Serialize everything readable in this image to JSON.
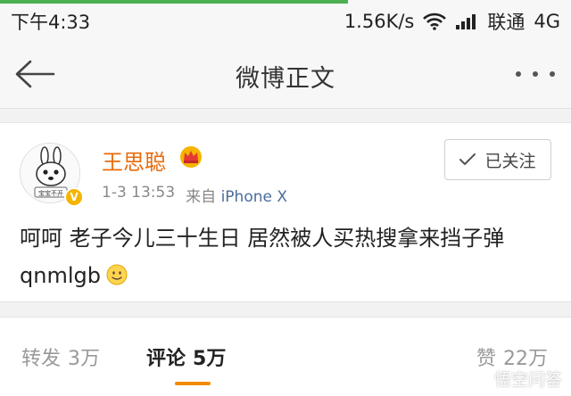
{
  "status_bar": {
    "time": "下午4:33",
    "network_speed": "1.56K/s",
    "carrier": "联通",
    "network_type": "4G",
    "progress_color": "#4caf50"
  },
  "nav": {
    "title": "微博正文",
    "back_icon": "arrow-left-icon",
    "more_icon": "more-dots-icon"
  },
  "post": {
    "username": "王思聪",
    "username_color": "#e86b0c",
    "badge_icon": "crown-icon",
    "avatar_text": "宝宝不开",
    "time": "1-3 13:53",
    "source_prefix": "来自",
    "device": "iPhone X",
    "follow_label": "已关注",
    "text": "呵呵 老子今儿三十生日 居然被人买热搜拿来挡子弹 qnmlgb",
    "emoji_icon": "smiley-emoji-icon"
  },
  "tabs": {
    "repost": {
      "label": "转发",
      "count": "3万"
    },
    "comment": {
      "label": "评论",
      "count": "5万"
    },
    "like": {
      "label": "赞",
      "count": "22万"
    },
    "accent_color": "#f28c00"
  },
  "watermark": {
    "text": "悟空问答"
  }
}
